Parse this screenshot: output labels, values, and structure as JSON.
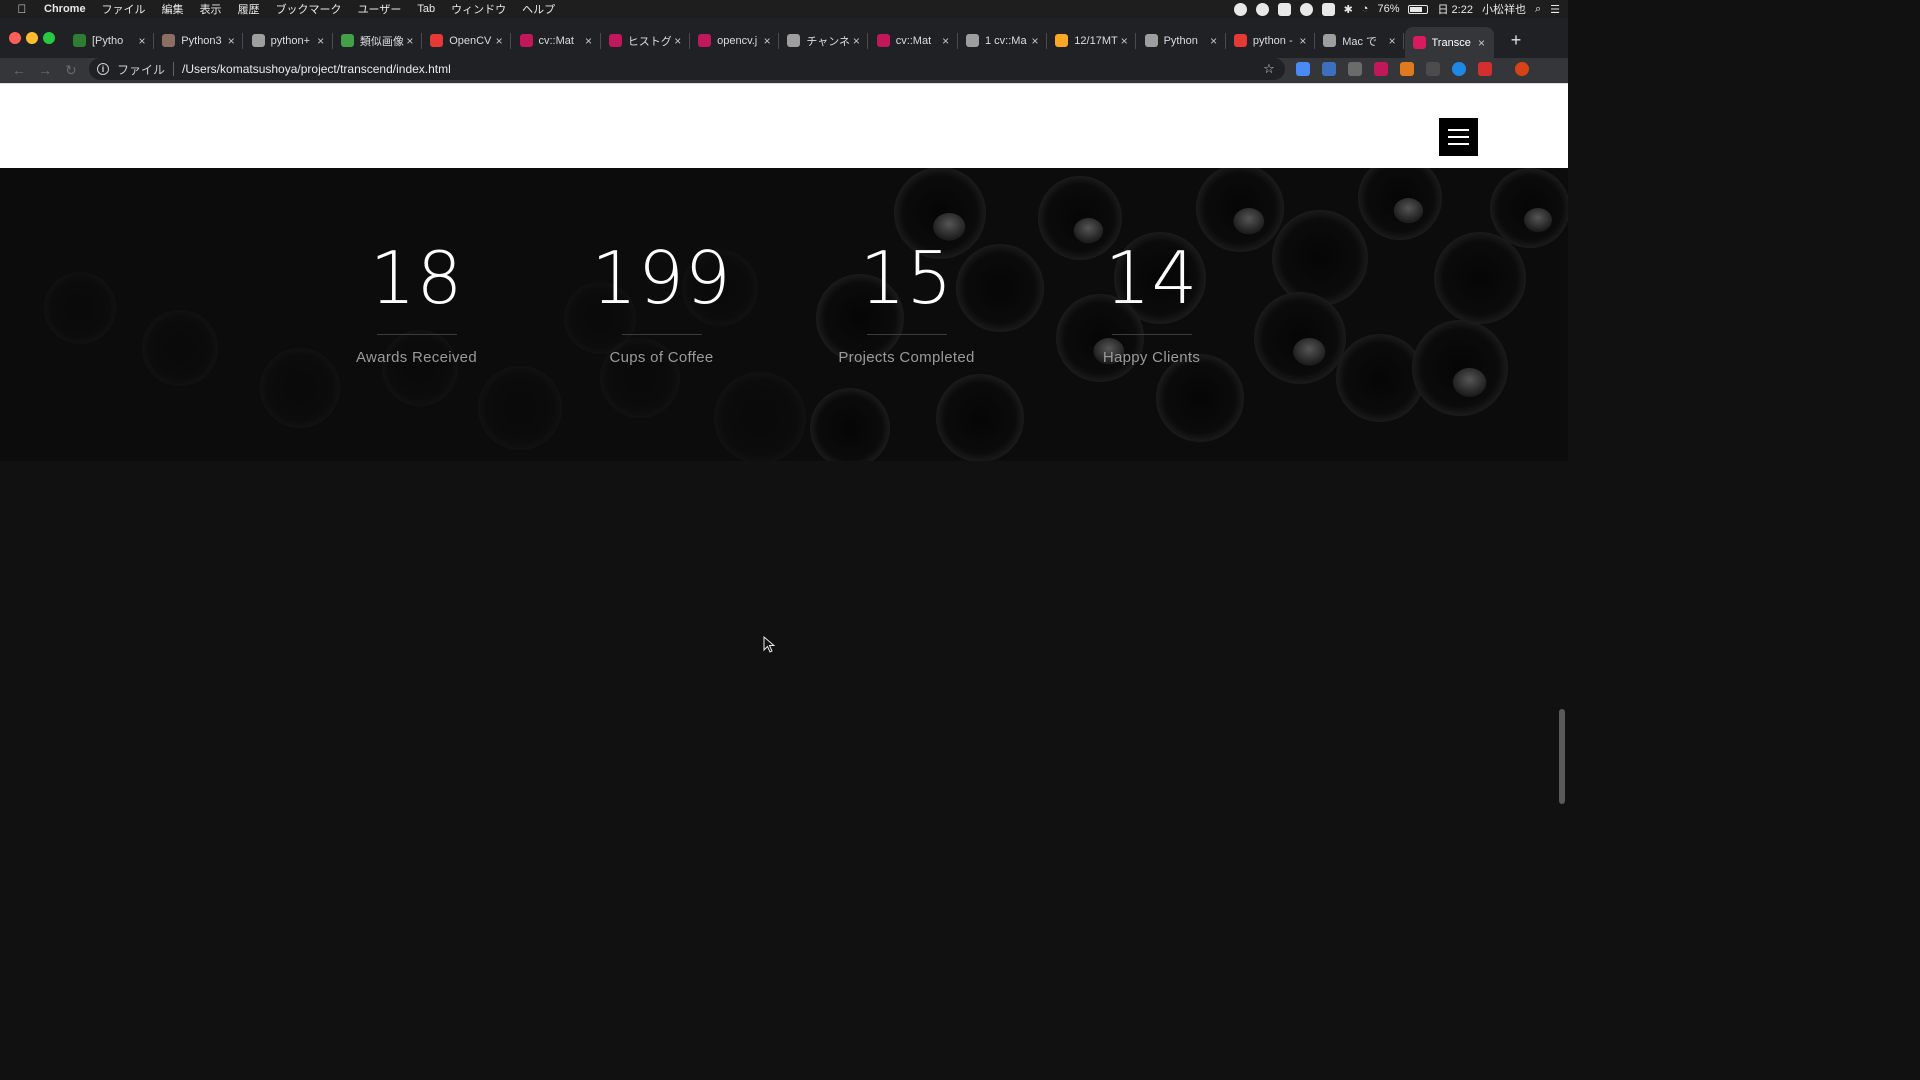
{
  "menubar": {
    "app": "Chrome",
    "items": [
      "ファイル",
      "編集",
      "表示",
      "履歴",
      "ブックマーク",
      "ユーザー",
      "Tab",
      "ウィンドウ",
      "ヘルプ"
    ],
    "battery": "76%",
    "clock": "日 2:22",
    "user": "小松祥也"
  },
  "tabs": [
    {
      "label": "[Pytho",
      "color": "#2e7d32"
    },
    {
      "label": "Python3",
      "color": "#8d6e63"
    },
    {
      "label": "python+",
      "color": "#9e9e9e"
    },
    {
      "label": "類似画像",
      "color": "#43a047"
    },
    {
      "label": "OpenCV",
      "color": "#e53935"
    },
    {
      "label": "cv::Mat",
      "color": "#c2185b"
    },
    {
      "label": "ヒストグ",
      "color": "#c2185b"
    },
    {
      "label": "opencv.j",
      "color": "#c2185b"
    },
    {
      "label": "チャンネ",
      "color": "#9e9e9e"
    },
    {
      "label": "cv::Mat",
      "color": "#c2185b"
    },
    {
      "label": "1 cv::Ma",
      "color": "#9e9e9e"
    },
    {
      "label": "12/17MT",
      "color": "#f9a825"
    },
    {
      "label": "Python",
      "color": "#9e9e9e"
    },
    {
      "label": "python -",
      "color": "#e53935"
    },
    {
      "label": "Mac で",
      "color": "#9e9e9e"
    },
    {
      "label": "Transce",
      "color": "#d81b60",
      "active": true
    }
  ],
  "toolbar": {
    "scheme": "ファイル",
    "url": "/Users/komatsushoya/project/transcend/index.html"
  },
  "stats": [
    {
      "value": "18",
      "label": "Awards Received"
    },
    {
      "value": "199",
      "label": "Cups of Coffee"
    },
    {
      "value": "15",
      "label": "Projects Completed"
    },
    {
      "value": "14",
      "label": "Happy Clients"
    }
  ]
}
